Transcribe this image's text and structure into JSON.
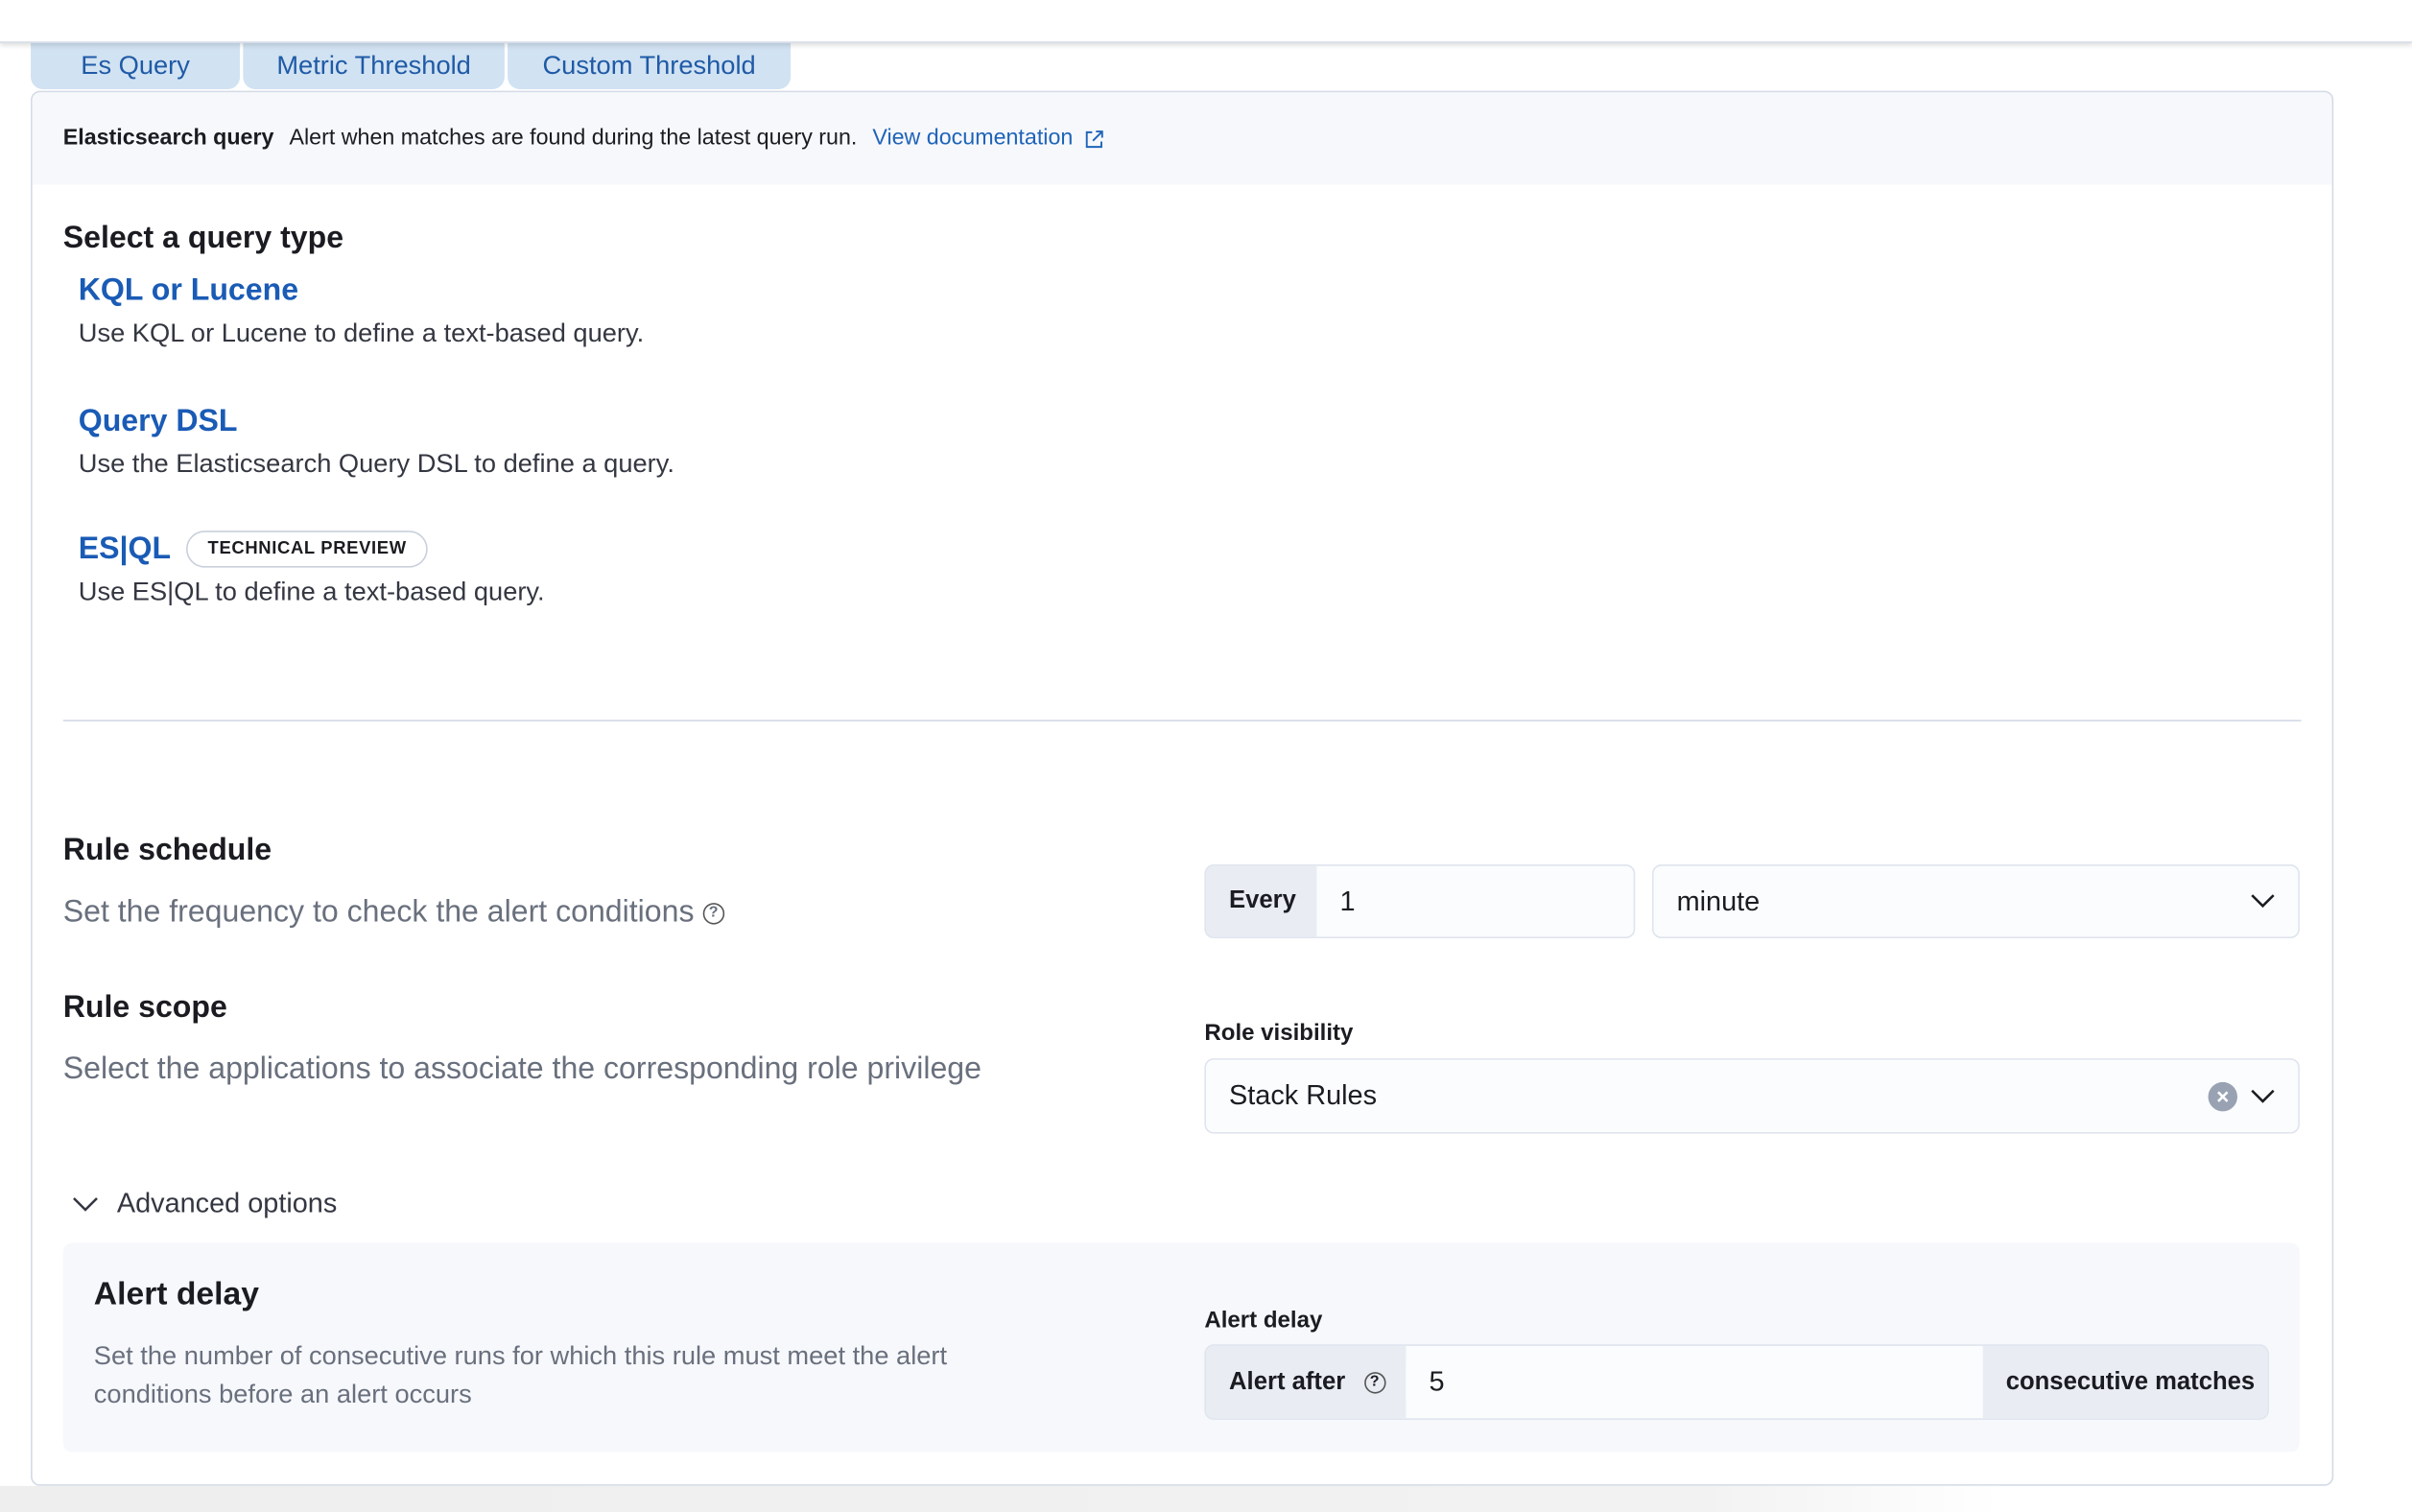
{
  "tabs": [
    {
      "label": "Es Query"
    },
    {
      "label": "Metric Threshold"
    },
    {
      "label": "Custom Threshold"
    }
  ],
  "header": {
    "title": "Elasticsearch query",
    "description": "Alert when matches are found during the latest query run.",
    "doc_link": "View documentation",
    "doc_icon": "external-link-icon"
  },
  "query_type": {
    "heading": "Select a query type",
    "options": [
      {
        "title": "KQL or Lucene",
        "description": "Use KQL or Lucene to define a text-based query."
      },
      {
        "title": "Query DSL",
        "description": "Use the Elasticsearch Query DSL to define a query."
      },
      {
        "title": "ES|QL",
        "badge": "TECHNICAL PREVIEW",
        "description": "Use ES|QL to define a text-based query."
      }
    ]
  },
  "schedule": {
    "heading": "Rule schedule",
    "description": "Set the frequency to check the alert conditions",
    "prepend": "Every",
    "value": "1",
    "unit": "minute"
  },
  "scope": {
    "heading": "Rule scope",
    "description": "Select the applications to associate the corresponding role privilege",
    "label": "Role visibility",
    "value": "Stack Rules"
  },
  "advanced": {
    "toggle": "Advanced options",
    "heading": "Alert delay",
    "description_1": "Set the number of consecutive runs for which this rule must meet the alert",
    "description_2": "conditions before an alert occurs",
    "label": "Alert delay",
    "prepend": "Alert after",
    "value": "5",
    "append": "consecutive matches"
  },
  "colors": {
    "link": "#1f64b8",
    "tab_bg": "#d1e2f2",
    "panel_bg": "#f7f8fc"
  }
}
